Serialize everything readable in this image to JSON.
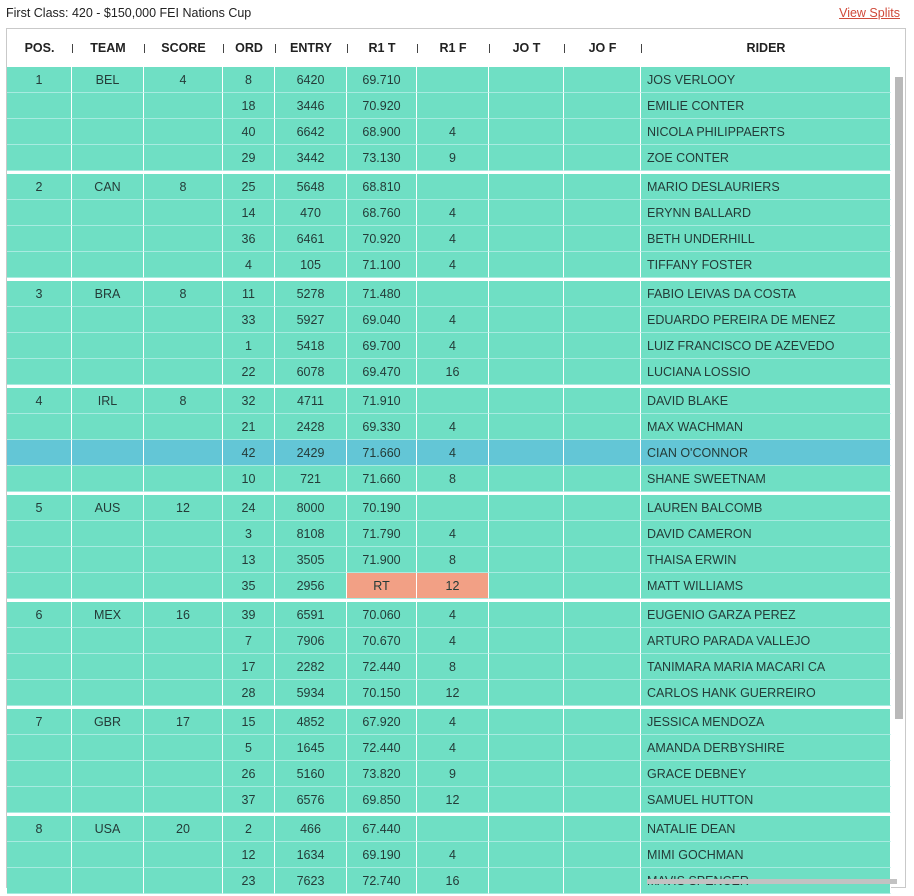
{
  "title": "First Class: 420 - $150,000 FEI Nations Cup",
  "view_splits": "View Splits",
  "columns": [
    "POS.",
    "TEAM",
    "SCORE",
    "ORD",
    "ENTRY",
    "R1 T",
    "R1 F",
    "JO T",
    "JO F",
    "RIDER"
  ],
  "rows": [
    {
      "pos": "1",
      "team": "BEL",
      "score": "4",
      "ord": "8",
      "entry": "6420",
      "r1t": "69.710",
      "r1f": "",
      "jot": "",
      "jof": "",
      "rider": "JOS VERLOOY"
    },
    {
      "pos": "",
      "team": "",
      "score": "",
      "ord": "18",
      "entry": "3446",
      "r1t": "70.920",
      "r1f": "",
      "jot": "",
      "jof": "",
      "rider": "EMILIE CONTER"
    },
    {
      "pos": "",
      "team": "",
      "score": "",
      "ord": "40",
      "entry": "6642",
      "r1t": "68.900",
      "r1f": "4",
      "jot": "",
      "jof": "",
      "rider": "NICOLA PHILIPPAERTS"
    },
    {
      "pos": "",
      "team": "",
      "score": "",
      "ord": "29",
      "entry": "3442",
      "r1t": "73.130",
      "r1f": "9",
      "jot": "",
      "jof": "",
      "rider": "ZOE CONTER"
    },
    {
      "pos": "2",
      "team": "CAN",
      "score": "8",
      "ord": "25",
      "entry": "5648",
      "r1t": "68.810",
      "r1f": "",
      "jot": "",
      "jof": "",
      "rider": "MARIO DESLAURIERS"
    },
    {
      "pos": "",
      "team": "",
      "score": "",
      "ord": "14",
      "entry": "470",
      "r1t": "68.760",
      "r1f": "4",
      "jot": "",
      "jof": "",
      "rider": "ERYNN BALLARD"
    },
    {
      "pos": "",
      "team": "",
      "score": "",
      "ord": "36",
      "entry": "6461",
      "r1t": "70.920",
      "r1f": "4",
      "jot": "",
      "jof": "",
      "rider": "BETH UNDERHILL"
    },
    {
      "pos": "",
      "team": "",
      "score": "",
      "ord": "4",
      "entry": "105",
      "r1t": "71.100",
      "r1f": "4",
      "jot": "",
      "jof": "",
      "rider": "TIFFANY FOSTER"
    },
    {
      "pos": "3",
      "team": "BRA",
      "score": "8",
      "ord": "11",
      "entry": "5278",
      "r1t": "71.480",
      "r1f": "",
      "jot": "",
      "jof": "",
      "rider": "FABIO LEIVAS DA COSTA"
    },
    {
      "pos": "",
      "team": "",
      "score": "",
      "ord": "33",
      "entry": "5927",
      "r1t": "69.040",
      "r1f": "4",
      "jot": "",
      "jof": "",
      "rider": "EDUARDO PEREIRA DE MENEZ"
    },
    {
      "pos": "",
      "team": "",
      "score": "",
      "ord": "1",
      "entry": "5418",
      "r1t": "69.700",
      "r1f": "4",
      "jot": "",
      "jof": "",
      "rider": "LUIZ FRANCISCO DE AZEVEDO"
    },
    {
      "pos": "",
      "team": "",
      "score": "",
      "ord": "22",
      "entry": "6078",
      "r1t": "69.470",
      "r1f": "16",
      "jot": "",
      "jof": "",
      "rider": "LUCIANA LOSSIO"
    },
    {
      "pos": "4",
      "team": "IRL",
      "score": "8",
      "ord": "32",
      "entry": "4711",
      "r1t": "71.910",
      "r1f": "",
      "jot": "",
      "jof": "",
      "rider": "DAVID BLAKE"
    },
    {
      "pos": "",
      "team": "",
      "score": "",
      "ord": "21",
      "entry": "2428",
      "r1t": "69.330",
      "r1f": "4",
      "jot": "",
      "jof": "",
      "rider": "MAX WACHMAN"
    },
    {
      "pos": "",
      "team": "",
      "score": "",
      "ord": "42",
      "entry": "2429",
      "r1t": "71.660",
      "r1f": "4",
      "jot": "",
      "jof": "",
      "rider": "CIAN O'CONNOR"
    },
    {
      "pos": "",
      "team": "",
      "score": "",
      "ord": "10",
      "entry": "721",
      "r1t": "71.660",
      "r1f": "8",
      "jot": "",
      "jof": "",
      "rider": "SHANE SWEETNAM"
    },
    {
      "pos": "5",
      "team": "AUS",
      "score": "12",
      "ord": "24",
      "entry": "8000",
      "r1t": "70.190",
      "r1f": "",
      "jot": "",
      "jof": "",
      "rider": "LAUREN BALCOMB"
    },
    {
      "pos": "",
      "team": "",
      "score": "",
      "ord": "3",
      "entry": "8108",
      "r1t": "71.790",
      "r1f": "4",
      "jot": "",
      "jof": "",
      "rider": "DAVID CAMERON"
    },
    {
      "pos": "",
      "team": "",
      "score": "",
      "ord": "13",
      "entry": "3505",
      "r1t": "71.900",
      "r1f": "8",
      "jot": "",
      "jof": "",
      "rider": "THAISA ERWIN"
    },
    {
      "pos": "",
      "team": "",
      "score": "",
      "ord": "35",
      "entry": "2956",
      "r1t": "RT",
      "r1f": "12",
      "jot": "",
      "jof": "",
      "rider": "MATT WILLIAMS"
    },
    {
      "pos": "6",
      "team": "MEX",
      "score": "16",
      "ord": "39",
      "entry": "6591",
      "r1t": "70.060",
      "r1f": "4",
      "jot": "",
      "jof": "",
      "rider": "EUGENIO GARZA PEREZ"
    },
    {
      "pos": "",
      "team": "",
      "score": "",
      "ord": "7",
      "entry": "7906",
      "r1t": "70.670",
      "r1f": "4",
      "jot": "",
      "jof": "",
      "rider": "ARTURO PARADA VALLEJO"
    },
    {
      "pos": "",
      "team": "",
      "score": "",
      "ord": "17",
      "entry": "2282",
      "r1t": "72.440",
      "r1f": "8",
      "jot": "",
      "jof": "",
      "rider": "TANIMARA MARIA MACARI CA"
    },
    {
      "pos": "",
      "team": "",
      "score": "",
      "ord": "28",
      "entry": "5934",
      "r1t": "70.150",
      "r1f": "12",
      "jot": "",
      "jof": "",
      "rider": "CARLOS HANK GUERREIRO"
    },
    {
      "pos": "7",
      "team": "GBR",
      "score": "17",
      "ord": "15",
      "entry": "4852",
      "r1t": "67.920",
      "r1f": "4",
      "jot": "",
      "jof": "",
      "rider": "JESSICA MENDOZA"
    },
    {
      "pos": "",
      "team": "",
      "score": "",
      "ord": "5",
      "entry": "1645",
      "r1t": "72.440",
      "r1f": "4",
      "jot": "",
      "jof": "",
      "rider": "AMANDA DERBYSHIRE"
    },
    {
      "pos": "",
      "team": "",
      "score": "",
      "ord": "26",
      "entry": "5160",
      "r1t": "73.820",
      "r1f": "9",
      "jot": "",
      "jof": "",
      "rider": "GRACE DEBNEY"
    },
    {
      "pos": "",
      "team": "",
      "score": "",
      "ord": "37",
      "entry": "6576",
      "r1t": "69.850",
      "r1f": "12",
      "jot": "",
      "jof": "",
      "rider": "SAMUEL HUTTON"
    },
    {
      "pos": "8",
      "team": "USA",
      "score": "20",
      "ord": "2",
      "entry": "466",
      "r1t": "67.440",
      "r1f": "",
      "jot": "",
      "jof": "",
      "rider": "NATALIE DEAN"
    },
    {
      "pos": "",
      "team": "",
      "score": "",
      "ord": "12",
      "entry": "1634",
      "r1t": "69.190",
      "r1f": "4",
      "jot": "",
      "jof": "",
      "rider": "MIMI GOCHMAN"
    },
    {
      "pos": "",
      "team": "",
      "score": "",
      "ord": "23",
      "entry": "7623",
      "r1t": "72.740",
      "r1f": "16",
      "jot": "",
      "jof": "",
      "rider": "MAVIS SPENCER"
    }
  ],
  "selected_row": 14,
  "highlighted_row": 19,
  "colors": {
    "cell": "#6fdfc4",
    "selected": "#63c6d6",
    "highlight": "#f2a085",
    "link": "#d04a3a"
  }
}
